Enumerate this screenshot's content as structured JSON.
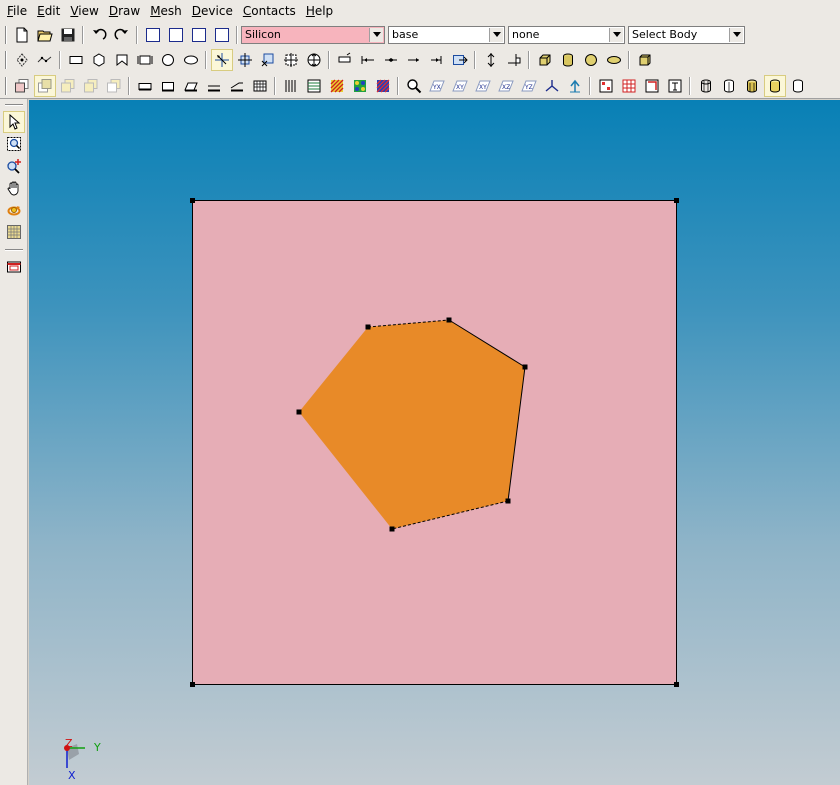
{
  "menu": [
    {
      "key": "F",
      "rest": "ile"
    },
    {
      "key": "E",
      "rest": "dit"
    },
    {
      "key": "V",
      "rest": "iew"
    },
    {
      "key": "D",
      "rest": "raw"
    },
    {
      "key": "M",
      "rest": "esh"
    },
    {
      "key": "D",
      "rest": "evice"
    },
    {
      "key": "C",
      "rest": "ontacts"
    },
    {
      "key": "H",
      "rest": "elp"
    }
  ],
  "toolbar": {
    "material": {
      "value": "Silicon",
      "bg": "#f7b4bd"
    },
    "region": {
      "value": "base"
    },
    "contact": {
      "value": "none"
    },
    "body": {
      "value": "Select Body"
    }
  },
  "scene": {
    "substrate_color": "#e6adb6",
    "hexagon_color": "#e88a28",
    "axes": {
      "z": "Z",
      "y": "Y",
      "x": "X",
      "z_color": "#d01010",
      "y_color": "#10a010",
      "x_color": "#1020d0"
    }
  }
}
